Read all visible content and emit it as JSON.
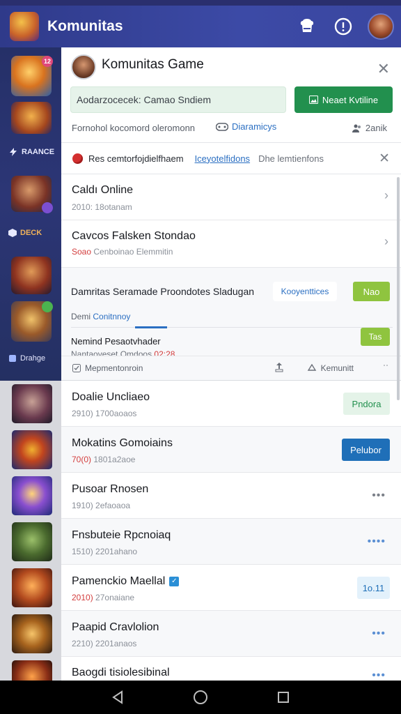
{
  "app": {
    "title": "Komunitas"
  },
  "sidebar": {
    "badge_top": "12",
    "label_1": "RAANCE",
    "label_2": "DECK",
    "label_3": "Drahge"
  },
  "panel": {
    "title": "Komunitas Game",
    "input_value": "Aodarzocecek: Camao Sndiem",
    "action_label": "Neaet Kvtiline",
    "meta_text": "Fornohol kocomord oleromonn",
    "meta_link": "Diaramicys",
    "meta_right": "2anik"
  },
  "notice": {
    "text": "Res cemtorfojdielfhaem",
    "link": "Iceyotelfidons",
    "sub": "Dhe lemtienfons"
  },
  "rows": [
    {
      "title": "Caldı Online",
      "sub": "2010:  18otanam"
    },
    {
      "title": "Cavcos Falsken Stondao",
      "sub_red": "Soao",
      "sub": "Cenboinao Elemmitin"
    }
  ],
  "card": {
    "title": "Damritas Seramade Proondotes Sladugan",
    "link": "Kooyenttices",
    "btn": "Nao",
    "tab_1": "Demi",
    "tab_2": "Conitnnoy",
    "sub_title": "Nemind Pesaotvhader",
    "sub_meta": "Nantaoveset Omdoos",
    "sub_meta_red": "02:28",
    "btn2": "Tas",
    "foot_left": "Mepmentonroin",
    "foot_mid": "Kemunitt",
    "foot_right": "ˈˈ"
  },
  "list": [
    {
      "title": "Doalie Uncliaeo",
      "sub": "2910)  1700aoaos",
      "button": "Pndora",
      "style": "light"
    },
    {
      "title": "Mokatins Gomoiains",
      "sub_red": "70(0)",
      "sub": "1801a2aoe",
      "button": "Pelubor",
      "style": "blue"
    },
    {
      "title": "Pusoar Rnosen",
      "sub": "1910)  2efaoaoa",
      "more": "•••"
    },
    {
      "title": "Fnsbuteie Rpcnoiaq",
      "sub": "1510)  2201ahano",
      "more": "••••"
    },
    {
      "title": "Pamenckio Maellal",
      "sub_red": "2010)",
      "sub": "27onaiane",
      "button": "1o.11",
      "style": "pale"
    },
    {
      "title": "Paapid Cravlolion",
      "sub": "2210)  2201anaos",
      "more": "•••"
    },
    {
      "title": "Baogdi tisiolesibinal",
      "sub": "",
      "more": "•••"
    }
  ],
  "colors": {
    "accent_green": "#22904e",
    "topbar": "#3c4aa6",
    "link_blue": "#2b6fc2"
  }
}
